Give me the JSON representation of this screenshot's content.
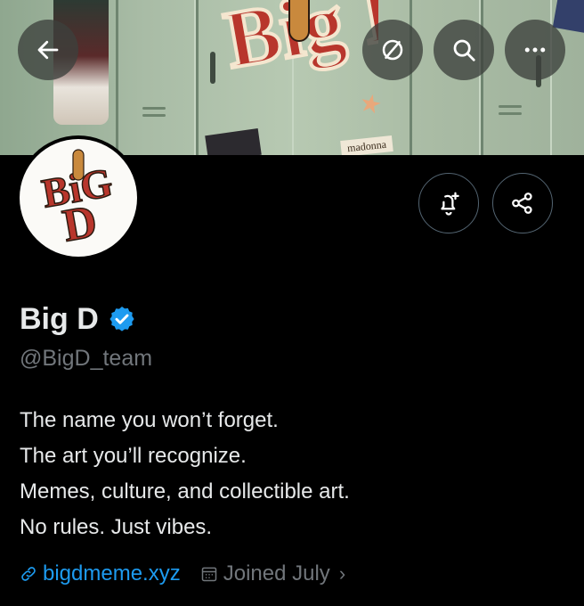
{
  "banner": {
    "logo_text": "Big D",
    "sticker_label": "madonna"
  },
  "top_bar": {
    "back_icon": "arrow-left-icon",
    "hide_icon": "eye-slash-icon",
    "search_icon": "search-icon",
    "more_icon": "more-icon"
  },
  "profile": {
    "display_name": "Big D",
    "verified": true,
    "handle": "@BigD_team",
    "bio_lines": [
      "The name you won’t forget.",
      "The art you’ll recognize.",
      "Memes, culture, and collectible art.",
      "No rules. Just vibes."
    ],
    "website": "bigdmeme.xyz",
    "joined": "Joined July",
    "chevron": "›"
  },
  "actions": {
    "notify_icon": "bell-plus-icon",
    "share_icon": "share-icon"
  },
  "colors": {
    "background": "#000000",
    "text_primary": "#e7e9ea",
    "text_secondary": "#71767b",
    "link": "#1d9bf0",
    "verified_badge": "#1d9bf0",
    "button_border": "#536471"
  }
}
